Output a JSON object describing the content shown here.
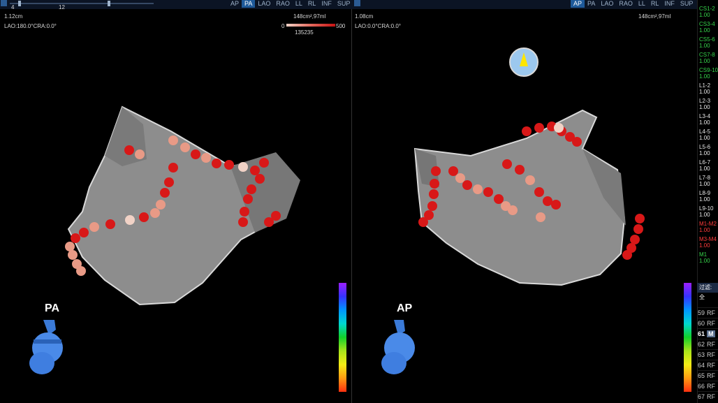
{
  "toolbar": {
    "slider_label_left": "4",
    "slider_label_right": "12",
    "left_view_tabs": [
      {
        "label": "AP",
        "active": false
      },
      {
        "label": "PA",
        "active": true
      },
      {
        "label": "LAO",
        "active": false
      },
      {
        "label": "RAO",
        "active": false
      },
      {
        "label": "LL",
        "active": false
      },
      {
        "label": "RL",
        "active": false
      },
      {
        "label": "INF",
        "active": false
      },
      {
        "label": "SUP",
        "active": false
      }
    ],
    "right_view_tabs": [
      {
        "label": "AP",
        "active": true
      },
      {
        "label": "PA",
        "active": false
      },
      {
        "label": "LAO",
        "active": false
      },
      {
        "label": "RAO",
        "active": false
      },
      {
        "label": "LL",
        "active": false
      },
      {
        "label": "RL",
        "active": false
      },
      {
        "label": "INF",
        "active": false
      },
      {
        "label": "SUP",
        "active": false
      }
    ]
  },
  "left_view": {
    "scale": "1.12cm",
    "angle": "LAO:180.0°CRA:0.0°",
    "volume": "148cm²,97ml",
    "legend_min": "0",
    "legend_max": "500",
    "legend_value": "135235",
    "orientation": "PA"
  },
  "right_view": {
    "scale": "1.08cm",
    "angle": "LAO:0.0°CRA:0.0°",
    "volume": "148cm²,97ml",
    "orientation": "AP"
  },
  "channels": [
    {
      "name": "CS1-2",
      "value": "1.00",
      "color": "#36d34a"
    },
    {
      "name": "CS3-4",
      "value": "1.00",
      "color": "#36d34a"
    },
    {
      "name": "CS5-6",
      "value": "1.00",
      "color": "#36d34a"
    },
    {
      "name": "CS7-8",
      "value": "1.00",
      "color": "#36d34a"
    },
    {
      "name": "CS9-10",
      "value": "1.00",
      "color": "#36d34a"
    },
    {
      "name": "L1-2",
      "value": "1.00",
      "color": "#e8e8e8"
    },
    {
      "name": "L2-3",
      "value": "1.00",
      "color": "#e8e8e8"
    },
    {
      "name": "L3-4",
      "value": "1.00",
      "color": "#e8e8e8"
    },
    {
      "name": "L4-5",
      "value": "1.00",
      "color": "#e8e8e8"
    },
    {
      "name": "L5-6",
      "value": "1.00",
      "color": "#e8e8e8"
    },
    {
      "name": "L6-7",
      "value": "1.00",
      "color": "#e8e8e8"
    },
    {
      "name": "L7-8",
      "value": "1.00",
      "color": "#e8e8e8"
    },
    {
      "name": "L8-9",
      "value": "1.00",
      "color": "#e8e8e8"
    },
    {
      "name": "L9-10",
      "value": "1.00",
      "color": "#e8e8e8"
    },
    {
      "name": "M1-M2",
      "value": "1.00",
      "color": "#ff3b3b"
    },
    {
      "name": "M3-M4",
      "value": "1.00",
      "color": "#ff3b3b"
    },
    {
      "name": "M1",
      "value": "1.00",
      "color": "#36d34a"
    }
  ],
  "filter_label": "过滤: 全",
  "point_list": [
    {
      "num": "59",
      "type": "RF",
      "selected": false
    },
    {
      "num": "60",
      "type": "RF",
      "selected": false
    },
    {
      "num": "61",
      "type": "M",
      "selected": true
    },
    {
      "num": "62",
      "type": "RF",
      "selected": false
    },
    {
      "num": "63",
      "type": "RF",
      "selected": false
    },
    {
      "num": "64",
      "type": "RF",
      "selected": false
    },
    {
      "num": "65",
      "type": "RF",
      "selected": false
    },
    {
      "num": "66",
      "type": "RF",
      "selected": false
    },
    {
      "num": "67",
      "type": "RF",
      "selected": false
    }
  ]
}
